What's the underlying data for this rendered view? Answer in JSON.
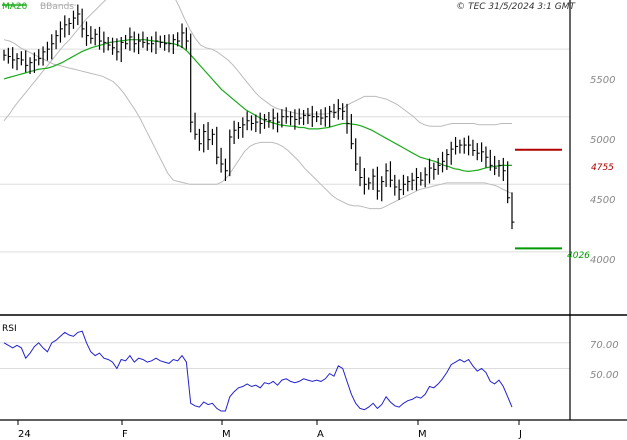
{
  "header": {
    "legend_ma": "MA20",
    "legend_bbands": "BBands",
    "copyright": "© TEC 31/5/2024 3:1 GMT"
  },
  "colors": {
    "ma": "#1aaa1a",
    "bbands": "#bbbbbb",
    "price": "#000000",
    "rsi": "#2222cc",
    "resistance": "#b00000",
    "support": "#009900",
    "grid": "#dddddd",
    "axis_text": "#888888"
  },
  "chart_data": [
    {
      "type": "line",
      "title": "",
      "subtitle": "",
      "xlabel": "",
      "ylabel": "",
      "x_tick_labels": [
        "24",
        "F",
        "M",
        "A",
        "M",
        "J"
      ],
      "y_ticks": [
        4000,
        4500,
        5000,
        5500
      ],
      "y_tick_labels": [
        "4000",
        "4500",
        "5000",
        "5500"
      ],
      "ylim": [
        3540,
        5760
      ],
      "grid": true,
      "legend_position": "top-left",
      "legend": [
        "MA20",
        "BBands"
      ],
      "levels": [
        {
          "name": "resistance",
          "label": "4755",
          "value": 4755
        },
        {
          "name": "support",
          "label": "4026",
          "value": 4026
        }
      ],
      "close": [
        5455,
        5445,
        5420,
        5430,
        5420,
        5380,
        5400,
        5420,
        5430,
        5480,
        5500,
        5540,
        5600,
        5650,
        5680,
        5690,
        5730,
        5760,
        5650,
        5600,
        5580,
        5610,
        5560,
        5550,
        5530,
        5510,
        5480,
        5550,
        5540,
        5590,
        5540,
        5560,
        5550,
        5540,
        5540,
        5560,
        5550,
        5540,
        5540,
        5570,
        5560,
        5620,
        5560,
        4960,
        4870,
        4800,
        4890,
        4830,
        4870,
        4700,
        4650,
        4600,
        4850,
        4900,
        4920,
        4940,
        4970,
        4950,
        4960,
        4950,
        4980,
        4970,
        4990,
        4960,
        5000,
        5000,
        5000,
        4980,
        4990,
        5010,
        5010,
        5000,
        5000,
        4990,
        5000,
        5040,
        5030,
        5060,
        5040,
        4950,
        4800,
        4650,
        4550,
        4500,
        4510,
        4560,
        4450,
        4520,
        4600,
        4530,
        4480,
        4460,
        4500,
        4520,
        4530,
        4550,
        4530,
        4570,
        4620,
        4610,
        4640,
        4670,
        4720,
        4760,
        4780,
        4790,
        4790,
        4790,
        4750,
        4730,
        4740,
        4700,
        4640,
        4620,
        4640,
        4600,
        4400,
        4220
      ],
      "ma20": [
        5280,
        5290,
        5300,
        5310,
        5320,
        5330,
        5340,
        5350,
        5355,
        5360,
        5370,
        5385,
        5400,
        5420,
        5440,
        5460,
        5480,
        5495,
        5510,
        5520,
        5530,
        5540,
        5550,
        5555,
        5560,
        5565,
        5570,
        5570,
        5570,
        5570,
        5565,
        5560,
        5555,
        5550,
        5545,
        5540,
        5530,
        5510,
        5480,
        5440,
        5400,
        5360,
        5320,
        5280,
        5240,
        5200,
        5170,
        5140,
        5110,
        5080,
        5050,
        5030,
        5010,
        4990,
        4970,
        4960,
        4950,
        4940,
        4935,
        4930,
        4930,
        4920,
        4920,
        4910,
        4910,
        4910,
        4915,
        4920,
        4930,
        4940,
        4950,
        4950,
        4945,
        4940,
        4930,
        4915,
        4900,
        4880,
        4860,
        4840,
        4820,
        4800,
        4780,
        4760,
        4740,
        4720,
        4700,
        4690,
        4680,
        4670,
        4655,
        4640,
        4630,
        4615,
        4610,
        4600,
        4595,
        4600,
        4605,
        4615,
        4625,
        4630,
        4635,
        4640,
        4640,
        4640
      ],
      "bb_upper": [
        4970,
        5020,
        5080,
        5130,
        5180,
        5230,
        5280,
        5330,
        5380,
        5430,
        5480,
        5530,
        5570,
        5620,
        5670,
        5720,
        5760,
        5800,
        5840,
        5880,
        5920,
        5960,
        5990,
        6020,
        6030,
        6030,
        6020,
        6000,
        5980,
        5960,
        5940,
        5900,
        5820,
        5730,
        5650,
        5580,
        5530,
        5510,
        5500,
        5480,
        5450,
        5420,
        5380,
        5330,
        5280,
        5230,
        5180,
        5140,
        5110,
        5080,
        5060,
        5050,
        5040,
        5030,
        5020,
        5020,
        5020,
        5020,
        5020,
        5020,
        5030,
        5040,
        5060,
        5090,
        5110,
        5130,
        5150,
        5150,
        5150,
        5140,
        5130,
        5110,
        5090,
        5060,
        5030,
        5000,
        4960,
        4940,
        4930,
        4930,
        4930,
        4940,
        4950,
        4950,
        4950,
        4950,
        4950,
        4940,
        4940,
        4940,
        4940,
        4950,
        4950,
        4950
      ],
      "bb_lower": [
        5570,
        5560,
        5540,
        5510,
        5490,
        5470,
        5450,
        5430,
        5410,
        5390,
        5380,
        5370,
        5360,
        5350,
        5340,
        5330,
        5320,
        5310,
        5300,
        5280,
        5260,
        5220,
        5170,
        5110,
        5050,
        4980,
        4900,
        4820,
        4740,
        4660,
        4580,
        4530,
        4520,
        4510,
        4500,
        4500,
        4500,
        4500,
        4500,
        4500,
        4520,
        4560,
        4620,
        4680,
        4740,
        4780,
        4800,
        4810,
        4810,
        4810,
        4800,
        4780,
        4750,
        4710,
        4670,
        4620,
        4580,
        4540,
        4500,
        4460,
        4420,
        4390,
        4370,
        4350,
        4340,
        4340,
        4330,
        4320,
        4320,
        4320,
        4340,
        4360,
        4380,
        4400,
        4420,
        4440,
        4460,
        4470,
        4480,
        4490,
        4500,
        4510,
        4510,
        4510,
        4510,
        4510,
        4510,
        4510,
        4510,
        4500,
        4490,
        4470,
        4450,
        4430
      ]
    },
    {
      "type": "line",
      "title": "RSI",
      "subtitle": "",
      "xlabel": "",
      "ylabel": "",
      "x_tick_labels": [
        "24",
        "F",
        "M",
        "A",
        "M",
        "J"
      ],
      "y_ticks": [
        50,
        70
      ],
      "y_tick_labels": [
        "50.00",
        "70.00"
      ],
      "ylim": [
        10,
        90
      ],
      "grid": true,
      "values": [
        70,
        68,
        66,
        68,
        66,
        58,
        62,
        67,
        70,
        66,
        63,
        70,
        72,
        75,
        78,
        76,
        75,
        78,
        79,
        70,
        63,
        60,
        62,
        58,
        57,
        55,
        50,
        57,
        56,
        60,
        55,
        58,
        57,
        55,
        56,
        58,
        56,
        55,
        54,
        57,
        56,
        60,
        55,
        23,
        21,
        20,
        24,
        22,
        23,
        19,
        17,
        17,
        28,
        32,
        35,
        36,
        38,
        36,
        37,
        35,
        39,
        38,
        40,
        37,
        41,
        42,
        40,
        39,
        40,
        42,
        41,
        40,
        41,
        40,
        42,
        46,
        44,
        52,
        50,
        40,
        30,
        23,
        19,
        18,
        20,
        23,
        19,
        22,
        28,
        24,
        21,
        20,
        23,
        25,
        26,
        28,
        27,
        30,
        36,
        35,
        38,
        42,
        47,
        53,
        55,
        57,
        55,
        57,
        52,
        48,
        50,
        47,
        40,
        38,
        41,
        36,
        28,
        20
      ]
    }
  ]
}
